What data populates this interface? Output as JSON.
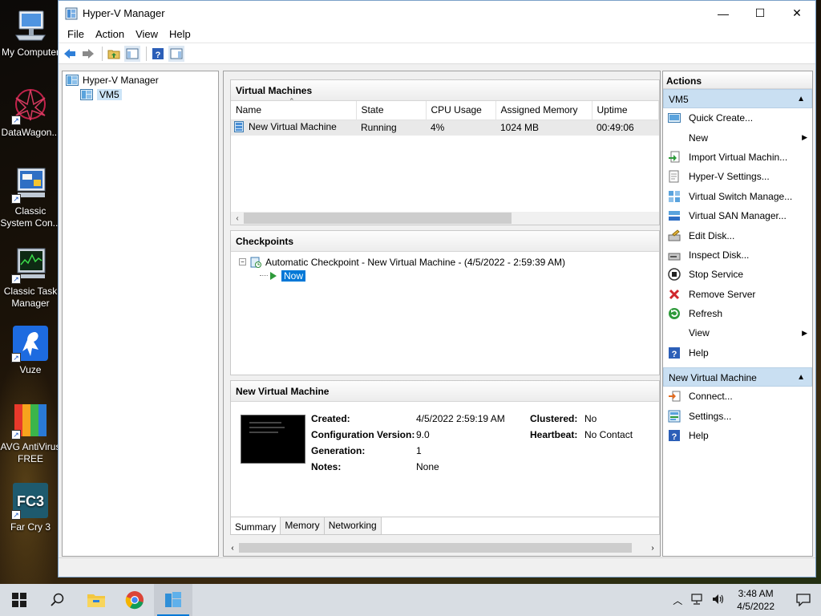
{
  "desktop": {
    "icons": [
      {
        "label": "My Computer",
        "icon": "computer-icon"
      },
      {
        "label": "DataWagon...",
        "icon": "datawagon-icon"
      },
      {
        "label": "Classic System Con...",
        "label_line1": "Classic",
        "label_line2": "System Con...",
        "icon": "control-panel-icon"
      },
      {
        "label": "Classic Task Manager",
        "label_line1": "Classic Task",
        "label_line2": "Manager",
        "icon": "task-manager-icon"
      },
      {
        "label": "Vuze",
        "icon": "vuze-icon"
      },
      {
        "label": "AVG AntiVirus FREE",
        "label_line1": "AVG AntiVirus",
        "label_line2": "FREE",
        "icon": "avg-icon"
      },
      {
        "label": "Far Cry 3",
        "icon": "farcry3-icon"
      }
    ]
  },
  "window": {
    "title": "Hyper-V Manager",
    "minimize": "—",
    "maximize": "☐",
    "close": "✕"
  },
  "menu": [
    "File",
    "Action",
    "View",
    "Help"
  ],
  "tree": {
    "root": "Hyper-V Manager",
    "server": "VM5"
  },
  "virtual_machines": {
    "heading": "Virtual Machines",
    "columns": [
      "Name",
      "State",
      "CPU Usage",
      "Assigned Memory",
      "Uptime"
    ],
    "rows": [
      {
        "name": "New Virtual Machine",
        "state": "Running",
        "cpu": "4%",
        "memory": "1024 MB",
        "uptime": "00:49:06"
      }
    ]
  },
  "checkpoints": {
    "heading": "Checkpoints",
    "items": [
      {
        "label": "Automatic Checkpoint - New Virtual Machine - (4/5/2022 - 2:59:39 AM)"
      }
    ],
    "now_label": "Now"
  },
  "details": {
    "heading": "New Virtual Machine",
    "fields": {
      "created_label": "Created:",
      "created": "4/5/2022 2:59:19 AM",
      "config_label": "Configuration Version:",
      "config": "9.0",
      "generation_label": "Generation:",
      "generation": "1",
      "notes_label": "Notes:",
      "notes": "None",
      "clustered_label": "Clustered:",
      "clustered": "No",
      "heartbeat_label": "Heartbeat:",
      "heartbeat": "No Contact"
    },
    "tabs": [
      "Summary",
      "Memory",
      "Networking"
    ],
    "active_tab": "Summary"
  },
  "actions": {
    "title": "Actions",
    "server_group": "VM5",
    "server_items": [
      {
        "label": "Quick Create...",
        "icon": "quick-create-icon"
      },
      {
        "label": "New",
        "icon": "",
        "submenu": true
      },
      {
        "label": "Import Virtual Machin...",
        "icon": "import-icon"
      },
      {
        "label": "Hyper-V Settings...",
        "icon": "settings-doc-icon"
      },
      {
        "label": "Virtual Switch Manage...",
        "icon": "switch-icon"
      },
      {
        "label": "Virtual SAN Manager...",
        "icon": "san-icon"
      },
      {
        "label": "Edit Disk...",
        "icon": "edit-disk-icon"
      },
      {
        "label": "Inspect Disk...",
        "icon": "inspect-disk-icon"
      },
      {
        "label": "Stop Service",
        "icon": "stop-icon"
      },
      {
        "label": "Remove Server",
        "icon": "remove-icon"
      },
      {
        "label": "Refresh",
        "icon": "refresh-icon"
      },
      {
        "label": "View",
        "icon": "",
        "submenu": true
      },
      {
        "label": "Help",
        "icon": "help-icon"
      }
    ],
    "vm_group": "New Virtual Machine",
    "vm_items": [
      {
        "label": "Connect...",
        "icon": "connect-icon"
      },
      {
        "label": "Settings...",
        "icon": "settings-icon"
      },
      {
        "label": "Help",
        "icon": "help-icon"
      }
    ]
  },
  "taskbar": {
    "time": "3:48 AM",
    "date": "4/5/2022"
  },
  "colors": {
    "selection": "#0078d7",
    "group_header": "#c9dff2",
    "taskbar": "#d8dde3"
  }
}
